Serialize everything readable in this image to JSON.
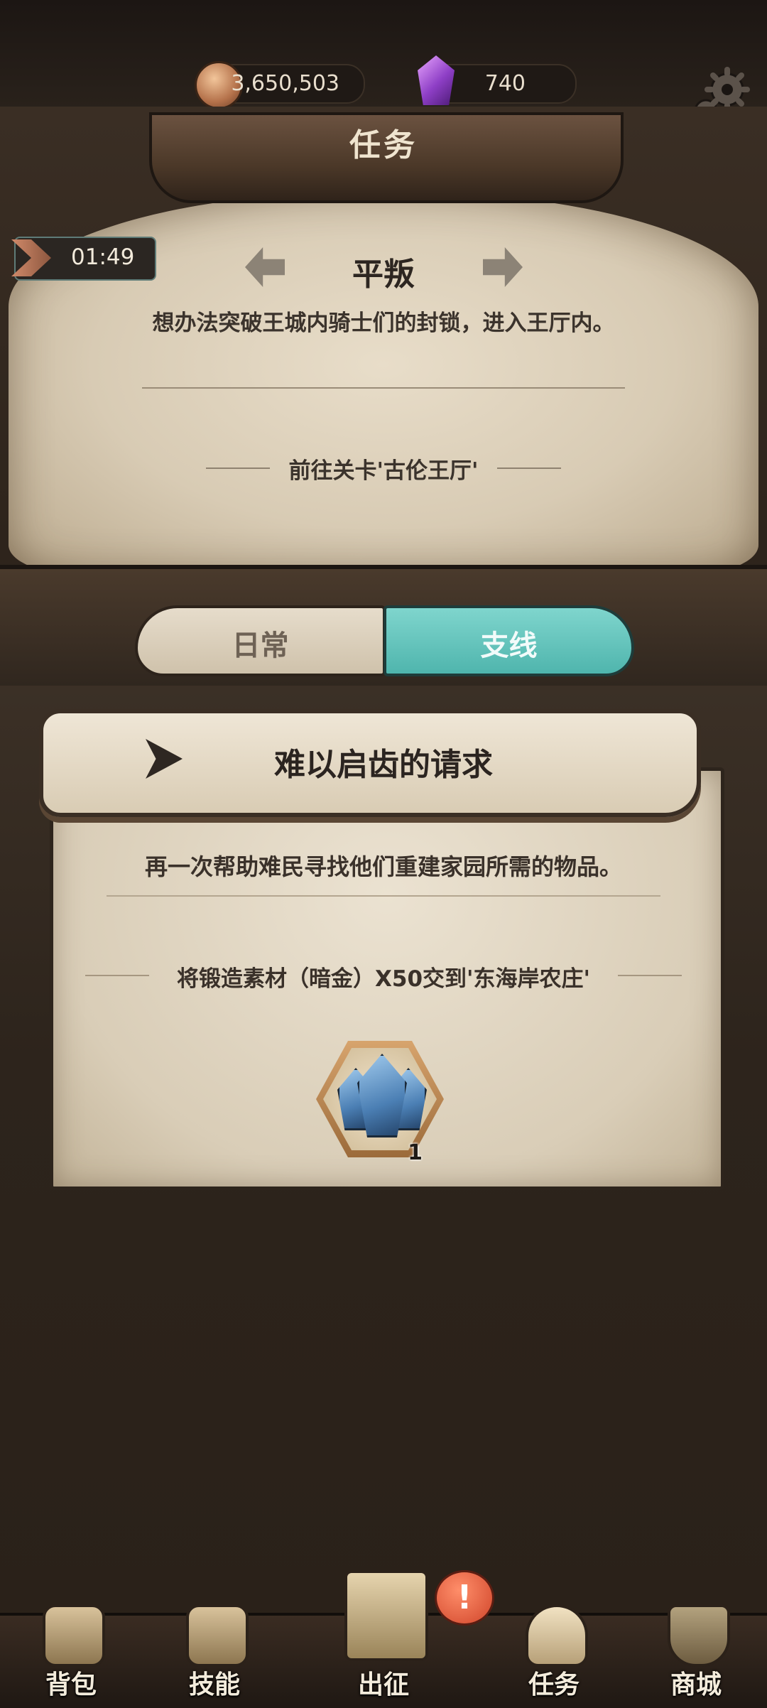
{
  "resources": {
    "coins": "3,650,503",
    "gems": "740"
  },
  "header": {
    "title": "任务"
  },
  "timer": {
    "value": "01:49"
  },
  "main_quest": {
    "title": "平叛",
    "description": "想办法突破王城内骑士们的封锁，进入王厅内。",
    "objective": "前往关卡'古伦王厅'"
  },
  "tabs": [
    {
      "label": "日常",
      "active": false
    },
    {
      "label": "支线",
      "active": true
    }
  ],
  "side_quest": {
    "title": "难以启齿的请求",
    "description": "再一次帮助难民寻找他们重建家园所需的物品。",
    "objective": "将锻造素材（暗金）X50交到'东海岸农庄'",
    "reward": {
      "icon": "mystery-crystal-icon",
      "quantity": "1"
    }
  },
  "bottom_nav": [
    {
      "label": "背包",
      "icon": "backpack-icon"
    },
    {
      "label": "技能",
      "icon": "skill-book-icon"
    },
    {
      "label": "出征",
      "icon": "map-sword-icon"
    },
    {
      "label": "任务",
      "icon": "horn-icon"
    },
    {
      "label": "商城",
      "icon": "shop-crest-icon"
    }
  ],
  "alert_badge": "!",
  "colors": {
    "active_tab": "#5fc4bc",
    "parchment": "#e3d7c2",
    "alert": "#e0553a"
  }
}
